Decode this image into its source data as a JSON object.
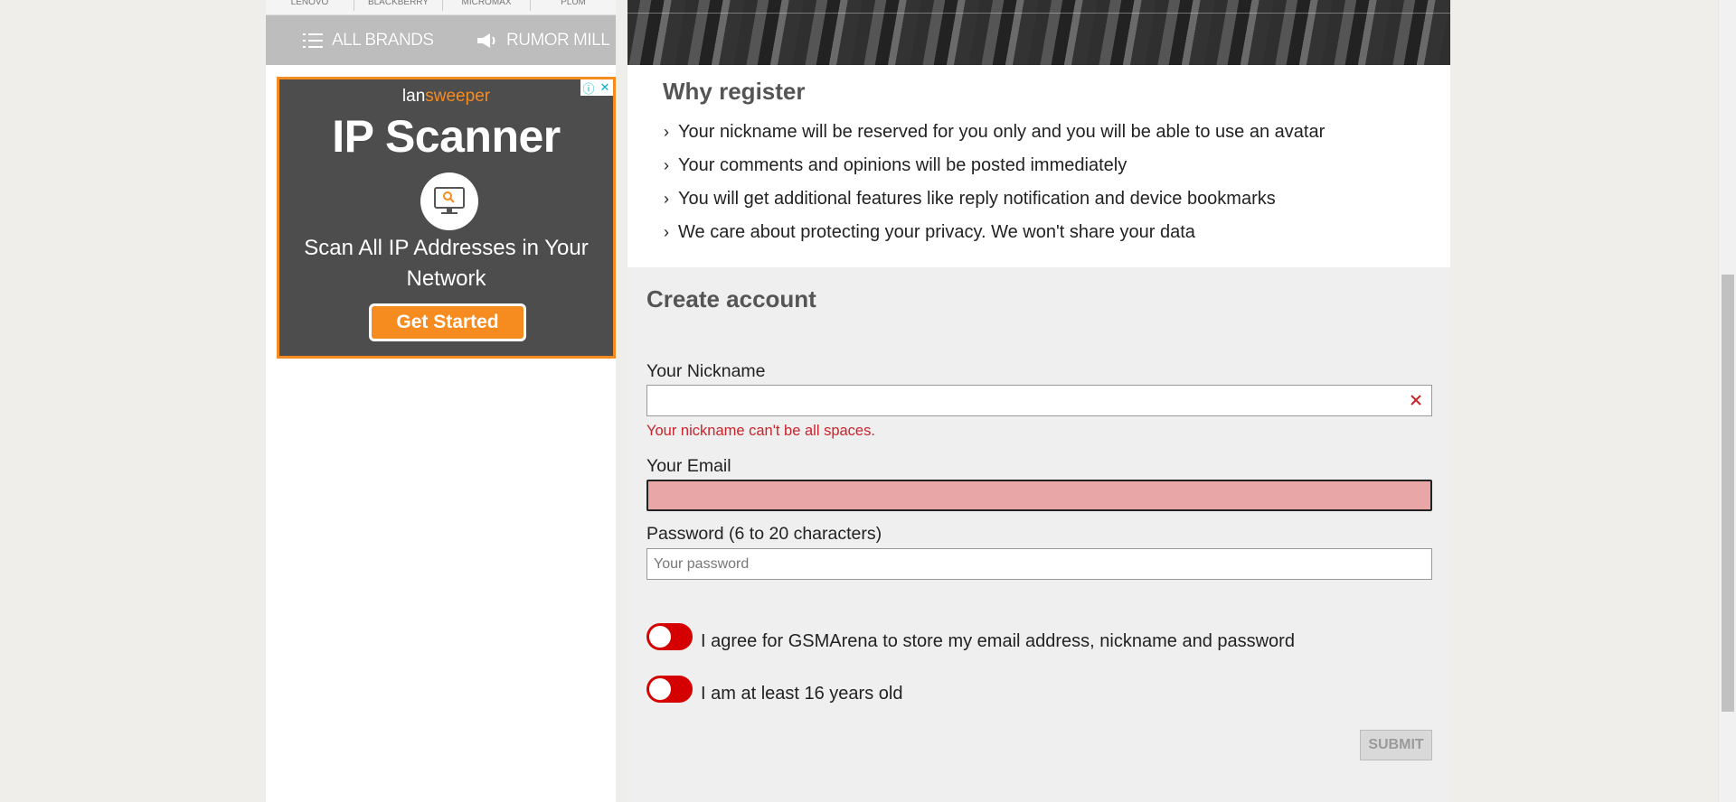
{
  "sidebar": {
    "brand_strip": [
      "LENOVO",
      "BLACKBERRY",
      "MICROMAX",
      "PLUM"
    ],
    "nav": {
      "all_brands": "ALL BRANDS",
      "rumor_mill": "RUMOR MILL"
    },
    "ad": {
      "logo_prefix": "lan",
      "logo_suffix": "sweeper",
      "title": "IP Scanner",
      "subtitle": "Scan All IP Addresses in Your Network",
      "cta": "Get Started",
      "info_icon": "ⓘ",
      "close_icon": "✕"
    }
  },
  "why_register": {
    "heading": "Why register",
    "bullets": [
      "Your nickname will be reserved for you only and you will be able to use an avatar",
      "Your comments and opinions will be posted immediately",
      "You will get additional features like reply notification and device bookmarks",
      "We care about protecting your privacy. We won't share your data"
    ]
  },
  "create_account": {
    "heading": "Create account",
    "nickname": {
      "label": "Your Nickname",
      "value": "",
      "error": "Your nickname can't be all spaces."
    },
    "email": {
      "label": "Your Email",
      "value": ""
    },
    "password": {
      "label": "Password (6 to 20 characters)",
      "placeholder": "Your password"
    },
    "agree_store": "I agree for GSMArena to store my email address, nickname and password",
    "agree_age": "I am at least 16 years old",
    "submit": "SUBMIT"
  },
  "colors": {
    "accent_red": "#d50000",
    "error_text": "#c9242b",
    "error_field_bg": "#e8a6a6",
    "ad_orange": "#f68b1f"
  }
}
